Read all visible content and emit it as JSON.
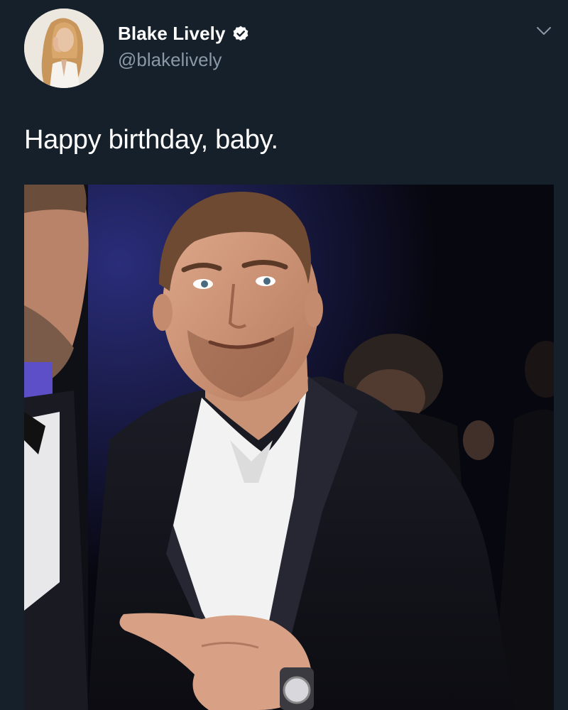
{
  "tweet": {
    "author": {
      "display_name": "Blake Lively",
      "handle": "@blakelively",
      "verified": true,
      "avatar_icon": "profile-photo"
    },
    "menu_icon": "chevron-down-icon",
    "text": "Happy birthday, baby.",
    "media": {
      "type": "photo",
      "description_icon": "tweet-photo"
    }
  },
  "colors": {
    "background": "#15202b",
    "primary_text": "#ffffff",
    "secondary_text": "#8b98a5"
  }
}
